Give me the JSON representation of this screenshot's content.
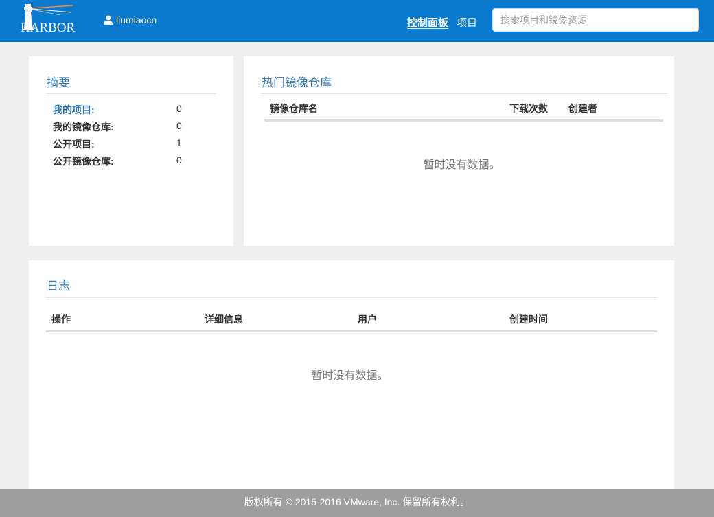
{
  "header": {
    "logo_text": "HARBOR",
    "username": "liumiaocn",
    "nav": [
      {
        "label": "控制面板",
        "active": true
      },
      {
        "label": "项目",
        "active": false
      }
    ],
    "search_placeholder": "搜索项目和镜像资源"
  },
  "summary": {
    "title": "摘要",
    "stats": [
      {
        "label": "我的项目:",
        "value": "0"
      },
      {
        "label": "我的镜像仓库:",
        "value": "0"
      },
      {
        "label": "公开项目:",
        "value": "1"
      },
      {
        "label": "公开镜像仓库:",
        "value": "0"
      }
    ]
  },
  "popular": {
    "title": "热门镜像仓库",
    "columns": [
      "镜像仓库名",
      "下载次数",
      "创建者"
    ],
    "empty_text": "暂时没有数据。"
  },
  "logs": {
    "title": "日志",
    "columns": [
      "操作",
      "详细信息",
      "用户",
      "创建时间"
    ],
    "empty_text": "暂时没有数据。"
  },
  "footer": {
    "text": "版权所有 © 2015-2016 VMware, Inc. 保留所有权利。"
  },
  "colors": {
    "header_bg": "#0a7acf",
    "title_blue": "#337ab7",
    "footer_bg": "#9e9e9e"
  }
}
